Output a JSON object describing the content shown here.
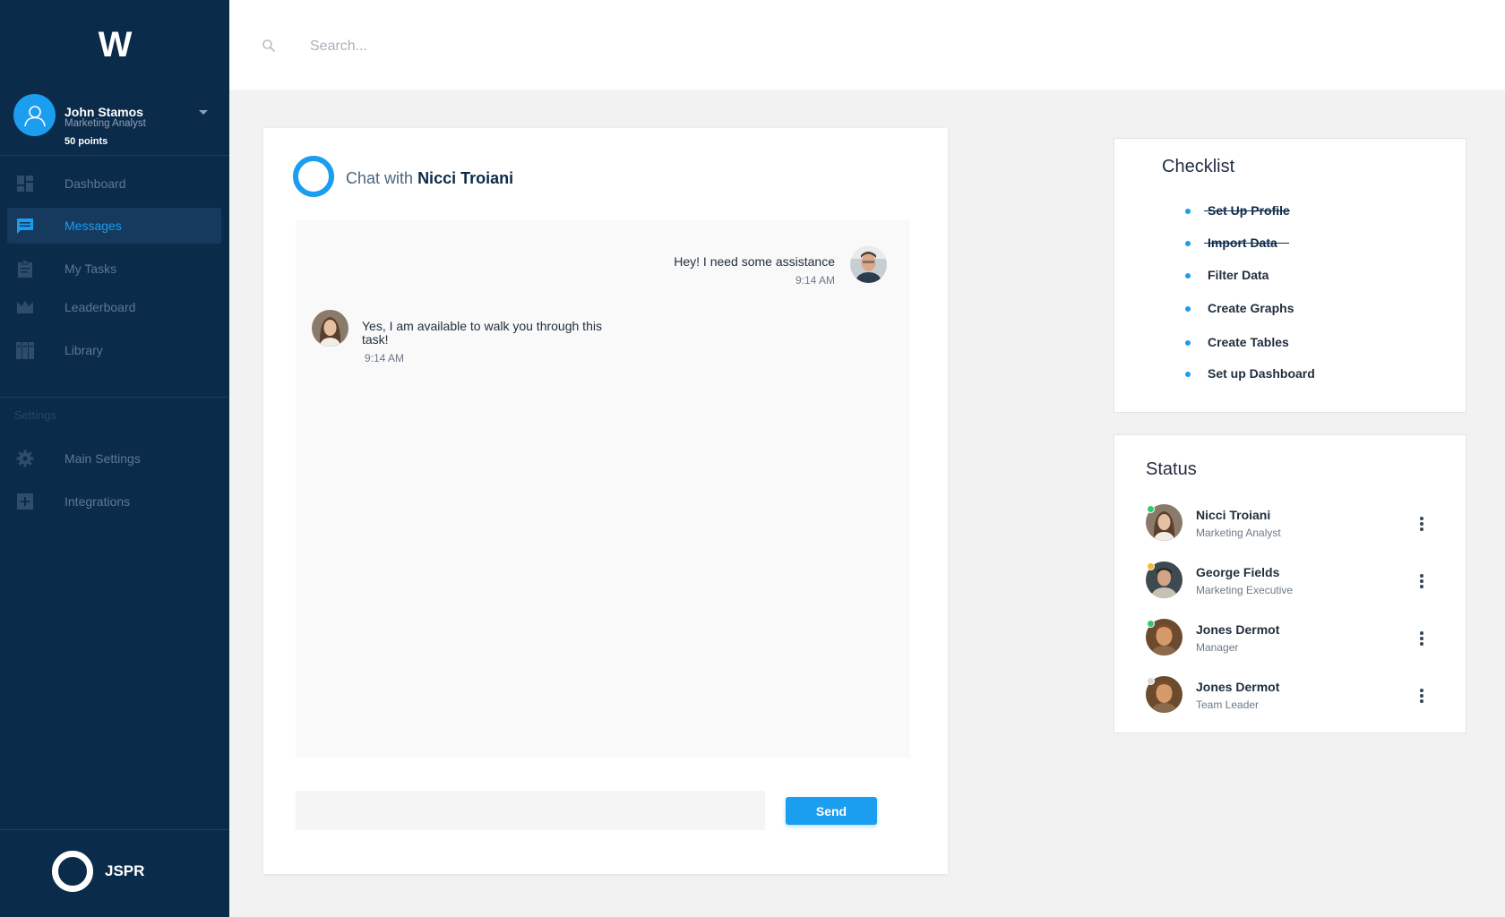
{
  "app": {
    "logo": "W",
    "brand": "JSPR"
  },
  "user": {
    "name": "John Stamos",
    "role": "Marketing Analyst",
    "points": "50 points"
  },
  "sidebar": {
    "items": [
      {
        "label": "Dashboard",
        "icon": "dashboard-icon"
      },
      {
        "label": "Messages",
        "icon": "message-icon",
        "active": true
      },
      {
        "label": "My Tasks",
        "icon": "clipboard-icon"
      },
      {
        "label": "Leaderboard",
        "icon": "crown-icon"
      },
      {
        "label": "Library",
        "icon": "library-icon"
      }
    ],
    "settings_heading": "Settings",
    "settings_items": [
      {
        "label": "Main Settings",
        "icon": "gear-icon"
      },
      {
        "label": "Integrations",
        "icon": "plus-box-icon"
      }
    ]
  },
  "search": {
    "placeholder": "Search..."
  },
  "chat": {
    "title_prefix": "Chat with",
    "contact_name": "Nicci Troiani",
    "messages": [
      {
        "direction": "outgoing",
        "text": "Hey! I need some assistance",
        "time": "9:14 AM"
      },
      {
        "direction": "incoming",
        "text": "Yes, I am available to walk you through this task!",
        "time": "9:14 AM"
      }
    ],
    "input_value": "",
    "send_label": "Send"
  },
  "checklist": {
    "title": "Checklist",
    "items": [
      {
        "label": "Set Up Profile",
        "done": true
      },
      {
        "label": "Import Data",
        "done": true
      },
      {
        "label": "Filter Data",
        "done": false
      },
      {
        "label": "Create Graphs",
        "done": false
      },
      {
        "label": "Create Tables",
        "done": false
      },
      {
        "label": "Set up Dashboard",
        "done": false
      }
    ]
  },
  "status": {
    "title": "Status",
    "people": [
      {
        "name": "Nicci Troiani",
        "role": "Marketing Analyst",
        "presence": "online",
        "presence_color": "#2ecc71"
      },
      {
        "name": "George Fields",
        "role": "Marketing Executive",
        "presence": "away",
        "presence_color": "#f5b82e"
      },
      {
        "name": "Jones Dermot",
        "role": "Manager",
        "presence": "online",
        "presence_color": "#2ecc71"
      },
      {
        "name": "Jones Dermot",
        "role": "Team Leader",
        "presence": "offline",
        "presence_color": "#d9d9d9"
      }
    ]
  },
  "colors": {
    "accent": "#1b9df0",
    "sidebar": "#0b2b4b"
  }
}
